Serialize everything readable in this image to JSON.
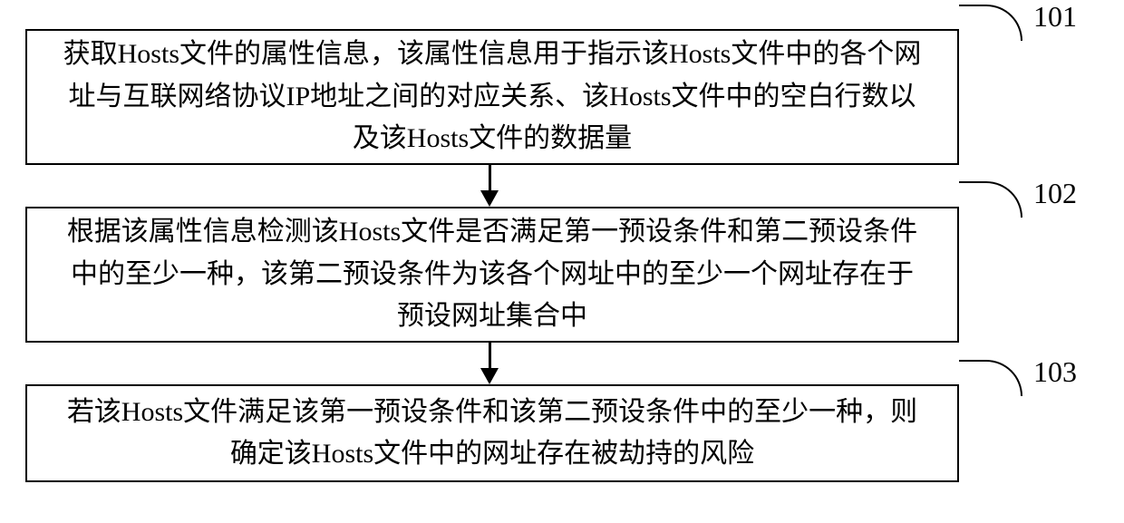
{
  "steps": [
    {
      "num": "101",
      "text": "获取Hosts文件的属性信息，该属性信息用于指示该Hosts文件中的各个网址与互联网络协议IP地址之间的对应关系、该Hosts文件中的空白行数以及该Hosts文件的数据量"
    },
    {
      "num": "102",
      "text": "根据该属性信息检测该Hosts文件是否满足第一预设条件和第二预设条件中的至少一种，该第二预设条件为该各个网址中的至少一个网址存在于预设网址集合中"
    },
    {
      "num": "103",
      "text": "若该Hosts文件满足该第一预设条件和该第二预设条件中的至少一种，则确定该Hosts文件中的网址存在被劫持的风险"
    }
  ]
}
